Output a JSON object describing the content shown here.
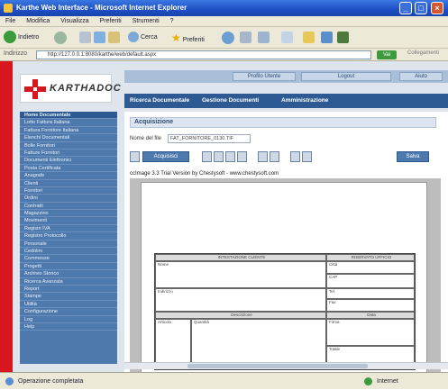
{
  "window": {
    "title": "Karthe Web Interface - Microsoft Internet Explorer"
  },
  "menu": [
    "File",
    "Modifica",
    "Visualizza",
    "Preferiti",
    "Strumenti",
    "?"
  ],
  "toolbar": {
    "back_label": "Indietro",
    "search_label": "Cerca",
    "favorites_label": "Preferiti"
  },
  "address": {
    "label": "Indirizzo",
    "url": "http://127.0.0.1:8080/karthe/web/default.aspx",
    "go_label": "Vai",
    "links_label": "Collegamenti"
  },
  "app": {
    "logo_text": "KARTHADOC",
    "top_buttons": [
      "Profilo Utente",
      "Logout",
      "Aiuto"
    ],
    "nav_tabs": [
      "Ricerca Documentale",
      "Gestione Documenti",
      "Amministrazione"
    ],
    "sidebar": [
      "Home Documentale",
      "Lotto Fattura Italiana",
      "Fattura Fornitore Italiana",
      "Elenchi Documentali",
      "Bolle Fornitori",
      "Fatture Fornitori",
      "Documenti Elettronici",
      "Posta Certificata",
      "Anagrafe",
      "Clienti",
      "Fornitori",
      "Ordini",
      "Contratti",
      "Magazzino",
      "Movimenti",
      "Registri IVA",
      "Registro Protocollo",
      "Personale",
      "Cedolini",
      "Commesse",
      "Progetti",
      "Archivio Storico",
      "Ricerca Avanzata",
      "Report",
      "Stampe",
      "Utilità",
      "Configurazione",
      "Log",
      "Help"
    ],
    "sidebar_active": 0,
    "section_title": "Acquisizione",
    "field_label": "Nome del file",
    "field_value": "FAT_FORNITORE_0130.TIF",
    "acquire_label": "Acquisisci",
    "right_button_label": "Salva",
    "viewer_caption": "ccImage 3.3 Trial Version by Chestysoft - www.chestysoft.com",
    "form_header_left": "INTESTAZIONE CLIENTE",
    "form_header_right": "RISERVATO UFFICIO",
    "form_labels": [
      "Nome",
      "Città",
      "CAP",
      "Indirizzo",
      "Tel.",
      "Fax",
      "Descrizione",
      "Articolo",
      "Quantità",
      "Data",
      "Firma",
      "Totale"
    ]
  },
  "status": {
    "left_text": "Operazione completata",
    "right_text": "Internet"
  },
  "colors": {
    "accent_red": "#d8161e",
    "nav_blue": "#2d5a93",
    "sidebar_blue": "#4e79ad",
    "xp_title": "#1e4fc4"
  }
}
